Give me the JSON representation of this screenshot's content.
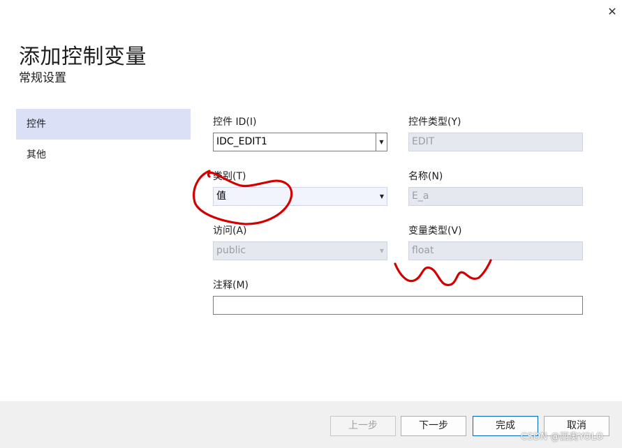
{
  "window": {
    "close_glyph": "✕",
    "title": "添加控制变量",
    "subtitle": "常规设置"
  },
  "nav": {
    "items": [
      {
        "label": "控件",
        "selected": true
      },
      {
        "label": "其他",
        "selected": false
      }
    ]
  },
  "form": {
    "control_id": {
      "label": "控件 ID(I)",
      "value": "IDC_EDIT1"
    },
    "control_type": {
      "label": "控件类型(Y)",
      "value": "EDIT"
    },
    "category": {
      "label": "类别(T)",
      "value": "值"
    },
    "name": {
      "label": "名称(N)",
      "value": "E_a"
    },
    "access": {
      "label": "访问(A)",
      "value": "public"
    },
    "var_type": {
      "label": "变量类型(V)",
      "value": "float"
    },
    "comment": {
      "label": "注释(M)",
      "value": ""
    }
  },
  "buttons": {
    "prev": "上一步",
    "next": "下一步",
    "finish": "完成",
    "cancel": "取消"
  },
  "watermark": "CSDN @西奥YOLO",
  "colors": {
    "nav_selected": "#dce0f7",
    "footer_bg": "#f0f0f0",
    "annotation_red": "#d40000",
    "primary_border": "#0067c0"
  }
}
